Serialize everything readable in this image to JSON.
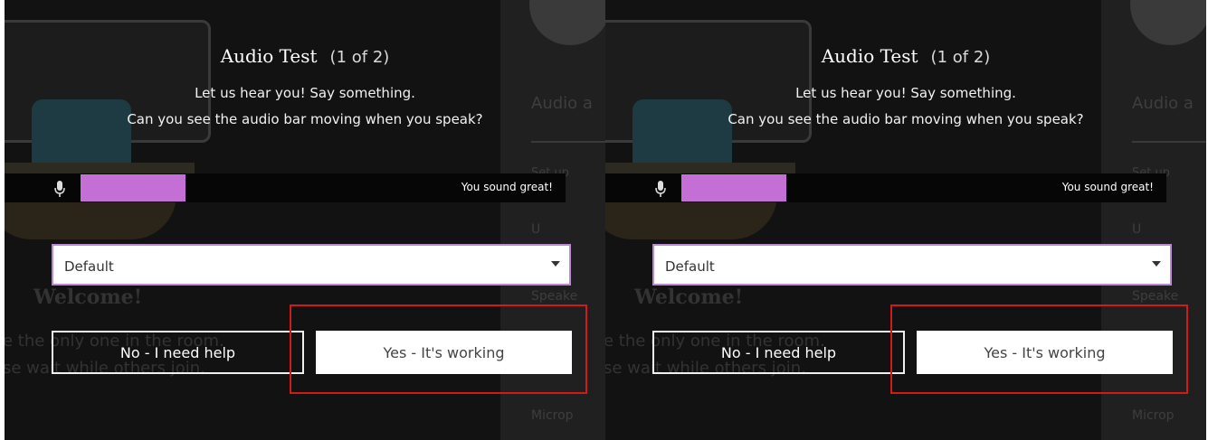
{
  "panels": [
    {
      "dialog": {
        "title": "Audio Test",
        "step": "(1 of 2)",
        "line1": "Let us hear you! Say something.",
        "line2": "Can you see the audio bar moving when you speak?",
        "status": "You sound great!",
        "level_fraction": 0.2,
        "device": "Default",
        "no_label": "No - I need help",
        "yes_label": "Yes - It's working"
      },
      "background": {
        "welcome": "Welcome!",
        "msg1": "e the only one in the room.",
        "msg2": "se wait while others join.",
        "side1": "Audio a",
        "side2": "Set up",
        "side3": "U",
        "side4": "Speake",
        "side5": "Microp"
      }
    },
    {
      "dialog": {
        "title": "Audio Test",
        "step": "(1 of 2)",
        "line1": "Let us hear you! Say something.",
        "line2": "Can you see the audio bar moving when you speak?",
        "status": "You sound great!",
        "level_fraction": 0.2,
        "device": "Default",
        "no_label": "No - I need help",
        "yes_label": "Yes - It's working"
      },
      "background": {
        "welcome": "Welcome!",
        "msg1": "e the only one in the room.",
        "msg2": "se wait while others join.",
        "side1": "Audio a",
        "side2": "Set up",
        "side3": "U",
        "side4": "Speake",
        "side5": "Microp"
      }
    }
  ],
  "colors": {
    "level_bar": "#c46fd6",
    "highlight": "#d11a1a",
    "overlay": "#121212"
  },
  "icons": {
    "mic": "microphone-icon",
    "dropdown": "caret-down-icon"
  }
}
